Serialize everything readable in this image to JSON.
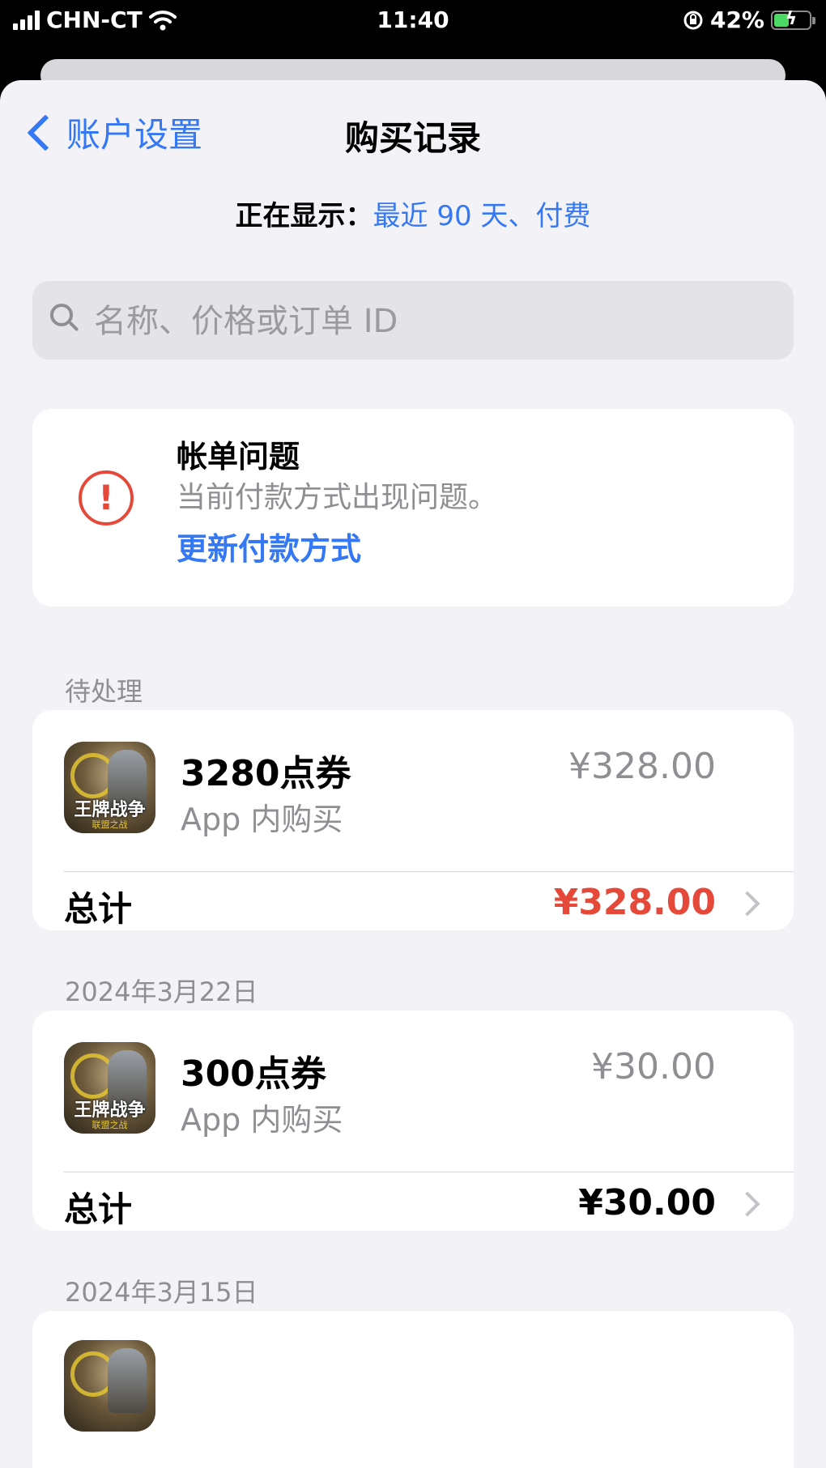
{
  "status_bar": {
    "carrier": "CHN-CT",
    "time": "11:40",
    "battery_percent": "42%",
    "battery_level": 0.42
  },
  "nav": {
    "back_label": "账户设置",
    "title": "购买记录"
  },
  "filter": {
    "label": "正在显示：",
    "value": "最近 90 天、付费"
  },
  "search": {
    "placeholder": "名称、价格或订单 ID"
  },
  "billing_alert": {
    "icon": "!",
    "title": "帐单问题",
    "description": "当前付款方式出现问题。",
    "action": "更新付款方式"
  },
  "sections": [
    {
      "label": "待处理",
      "item_name": "3280点券",
      "item_type": "App 内购买",
      "item_price": "¥328.00",
      "total_label": "总计",
      "total_value": "¥328.00",
      "app_logo": "王牌战争",
      "app_logo_sub": "联盟之战"
    },
    {
      "label": "2024年3月22日",
      "item_name": "300点券",
      "item_type": "App 内购买",
      "item_price": "¥30.00",
      "total_label": "总计",
      "total_value": "¥30.00",
      "app_logo": "王牌战争",
      "app_logo_sub": "联盟之战"
    },
    {
      "label": "2024年3月15日"
    }
  ],
  "colors": {
    "accent": "#3478f6",
    "alert": "#e5493a",
    "secondary_text": "#8e8e93",
    "background": "#f2f2f7"
  }
}
